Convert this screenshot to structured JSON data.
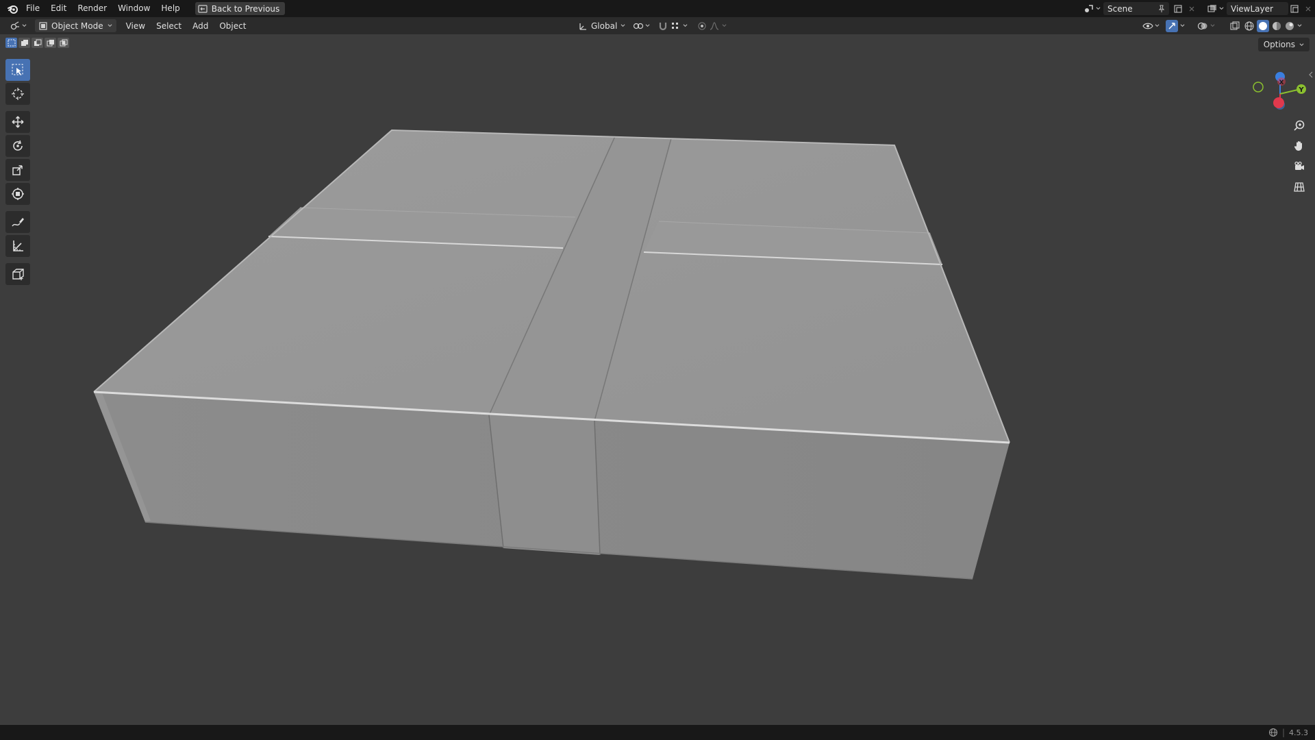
{
  "app": {
    "name": "Blender",
    "version": "4.5.3"
  },
  "menu": {
    "items": [
      "File",
      "Edit",
      "Render",
      "Window",
      "Help"
    ],
    "back_to_previous": "Back to Previous"
  },
  "scene": {
    "label": "Scene"
  },
  "view_layer": {
    "label": "ViewLayer"
  },
  "header": {
    "mode": "Object Mode",
    "menus": [
      "View",
      "Select",
      "Add",
      "Object"
    ],
    "transform_orientation": "Global"
  },
  "viewport": {
    "options_label": "Options",
    "gizmo_axes": {
      "x": "X",
      "y": "Y"
    }
  },
  "toolbar": {
    "tools": [
      "select-box",
      "cursor",
      "move",
      "rotate",
      "scale",
      "transform",
      "annotate",
      "measure",
      "add-cube"
    ],
    "active": "select-box"
  },
  "colors": {
    "accent": "#4772b3",
    "axis_x": "#e0394d",
    "axis_y": "#8bc02f",
    "axis_z": "#3a7fe0",
    "mesh": "#8f8f8f"
  }
}
